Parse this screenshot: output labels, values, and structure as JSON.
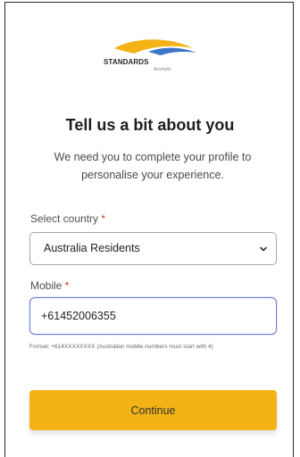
{
  "brand": {
    "name": "STANDARDS",
    "sub": "Australia"
  },
  "heading": {
    "title": "Tell us a bit about you",
    "subtitle": "We need you to complete your profile to personalise your experience."
  },
  "country": {
    "label": "Select country",
    "required_mark": "*",
    "selected": "Australia Residents"
  },
  "mobile": {
    "label": "Mobile",
    "required_mark": "*",
    "value": "+61452006355",
    "hint": "Format: +614XXXXXXXX (Australian mobile numbers must start with 4)"
  },
  "actions": {
    "continue_label": "Continue"
  },
  "colors": {
    "accent": "#f3b317",
    "focus_border": "#6f76e0",
    "required": "#d9342b"
  }
}
